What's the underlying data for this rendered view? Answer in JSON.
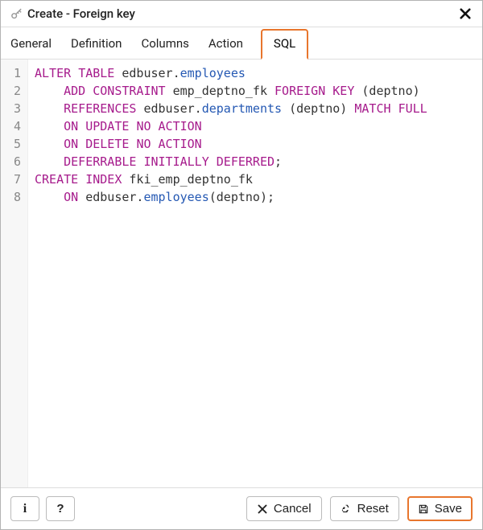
{
  "title": "Create - Foreign key",
  "tabs": [
    {
      "label": "General",
      "active": false
    },
    {
      "label": "Definition",
      "active": false
    },
    {
      "label": "Columns",
      "active": false
    },
    {
      "label": "Action",
      "active": false
    },
    {
      "label": "SQL",
      "active": true
    }
  ],
  "code": {
    "lines": [
      [
        {
          "t": "kw",
          "v": "ALTER"
        },
        {
          "t": "plain",
          "v": " "
        },
        {
          "t": "kw",
          "v": "TABLE"
        },
        {
          "t": "plain",
          "v": " edbuser."
        },
        {
          "t": "id",
          "v": "employees"
        }
      ],
      [
        {
          "t": "plain",
          "v": "    "
        },
        {
          "t": "kw",
          "v": "ADD"
        },
        {
          "t": "plain",
          "v": " "
        },
        {
          "t": "kw",
          "v": "CONSTRAINT"
        },
        {
          "t": "plain",
          "v": " emp_deptno_fk "
        },
        {
          "t": "kw",
          "v": "FOREIGN"
        },
        {
          "t": "plain",
          "v": " "
        },
        {
          "t": "kw",
          "v": "KEY"
        },
        {
          "t": "plain",
          "v": " (deptno)"
        }
      ],
      [
        {
          "t": "plain",
          "v": "    "
        },
        {
          "t": "kw",
          "v": "REFERENCES"
        },
        {
          "t": "plain",
          "v": " edbuser."
        },
        {
          "t": "id",
          "v": "departments"
        },
        {
          "t": "plain",
          "v": " (deptno) "
        },
        {
          "t": "kw",
          "v": "MATCH"
        },
        {
          "t": "plain",
          "v": " "
        },
        {
          "t": "kw",
          "v": "FULL"
        }
      ],
      [
        {
          "t": "plain",
          "v": "    "
        },
        {
          "t": "kw",
          "v": "ON"
        },
        {
          "t": "plain",
          "v": " "
        },
        {
          "t": "kw",
          "v": "UPDATE"
        },
        {
          "t": "plain",
          "v": " "
        },
        {
          "t": "kw",
          "v": "NO"
        },
        {
          "t": "plain",
          "v": " "
        },
        {
          "t": "kw",
          "v": "ACTION"
        }
      ],
      [
        {
          "t": "plain",
          "v": "    "
        },
        {
          "t": "kw",
          "v": "ON"
        },
        {
          "t": "plain",
          "v": " "
        },
        {
          "t": "kw",
          "v": "DELETE"
        },
        {
          "t": "plain",
          "v": " "
        },
        {
          "t": "kw",
          "v": "NO"
        },
        {
          "t": "plain",
          "v": " "
        },
        {
          "t": "kw",
          "v": "ACTION"
        }
      ],
      [
        {
          "t": "plain",
          "v": "    "
        },
        {
          "t": "kw",
          "v": "DEFERRABLE"
        },
        {
          "t": "plain",
          "v": " "
        },
        {
          "t": "kw",
          "v": "INITIALLY"
        },
        {
          "t": "plain",
          "v": " "
        },
        {
          "t": "kw",
          "v": "DEFERRED"
        },
        {
          "t": "plain",
          "v": ";"
        }
      ],
      [
        {
          "t": "kw",
          "v": "CREATE"
        },
        {
          "t": "plain",
          "v": " "
        },
        {
          "t": "kw",
          "v": "INDEX"
        },
        {
          "t": "plain",
          "v": " fki_emp_deptno_fk"
        }
      ],
      [
        {
          "t": "plain",
          "v": "    "
        },
        {
          "t": "kw",
          "v": "ON"
        },
        {
          "t": "plain",
          "v": " edbuser."
        },
        {
          "t": "id",
          "v": "employees"
        },
        {
          "t": "plain",
          "v": "(deptno);"
        }
      ]
    ]
  },
  "footer": {
    "info_tooltip": "i",
    "help_tooltip": "?",
    "cancel": "Cancel",
    "reset": "Reset",
    "save": "Save"
  }
}
